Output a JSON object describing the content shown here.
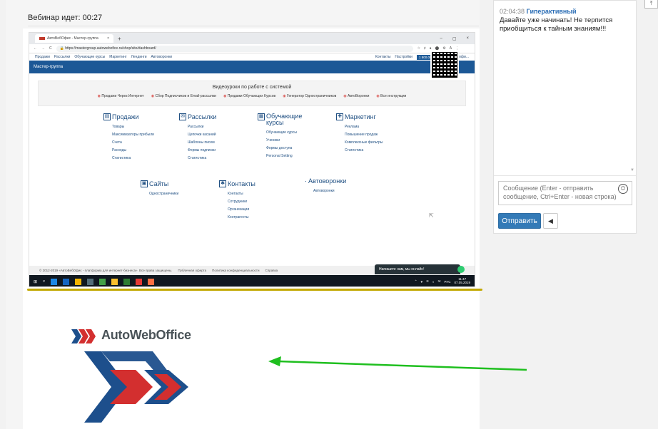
{
  "webinar": {
    "status_label": "Вебинар идет: 00:27"
  },
  "browser": {
    "tab_title": "АвтоВебОфис - Мастер-группа",
    "tab_close": "×",
    "tab_add": "+",
    "window_controls": [
      "–",
      "▢",
      "×"
    ],
    "nav_buttons": [
      "←",
      "→",
      "C"
    ],
    "url": "https://mastergroup.autowebofice.ru/shop/site/dashboard/",
    "extensions": [
      "☆",
      "♯",
      "●",
      "⬤",
      "⚙",
      "A",
      "⋮"
    ]
  },
  "site": {
    "topnav_left": [
      "Продажи",
      "Рассылки",
      "Обучающие курсы",
      "Маркетинг",
      "Лендинги",
      "Автоворонки"
    ],
    "topnav_right": [
      "Контакты",
      "Настройки"
    ],
    "balance": "1 800.00 RUB",
    "user": "Кодек в офи...",
    "header_title": "Мастер-группа",
    "video_title": "Видеоуроки по работе с системой",
    "video_links": [
      "Продажи Через Интернет",
      "Сбор Подписчиков и Email-рассылки",
      "Продажи Обучающих Курсов",
      "Генератор Одностраничников",
      "АвтоВоронки",
      "Все инструкции"
    ],
    "categories": [
      {
        "title": "Продажи",
        "icon": "▤",
        "items": [
          "Товары",
          "Максимизаторы прибыли",
          "Счета",
          "Расходы",
          "Статистика"
        ]
      },
      {
        "title": "Рассылки",
        "icon": "✉",
        "items": [
          "Рассылки",
          "Цепочки касаний",
          "Шаблоны писем",
          "Формы подписки",
          "Статистика"
        ]
      },
      {
        "title": "Обучающие курсы",
        "icon": "▦",
        "items": [
          "Обучающие курсы",
          "Ученики",
          "Формы доступа",
          "Personal Setting"
        ]
      },
      {
        "title": "Маркетинг",
        "icon": "✚",
        "items": [
          "Реклама",
          "Повышение продаж",
          "Комплексные фильтры",
          "Статистика"
        ]
      },
      {
        "title": "Сайты",
        "icon": "▣",
        "items": [
          "Одностраничники"
        ]
      },
      {
        "title": "Контакты",
        "icon": "✱",
        "items": [
          "Контакты",
          "Сотрудники",
          "Организации",
          "Контрагенты"
        ]
      },
      {
        "title": "Автоворонки",
        "icon": "·",
        "items": [
          "Автоворонки"
        ]
      }
    ],
    "footer": [
      "© 2012-2019 «АвтоВебОфис - платформа для интернет-бизнеса». Все права защищены.",
      "Публичная оферта",
      "Политика конфиденциальности",
      "Справка"
    ],
    "chat_widget": "Напишите нам, мы онлайн!",
    "cursor": "⇱"
  },
  "taskbar": {
    "start": "⊞",
    "search": "⌕",
    "lang": "РУС",
    "time": "11:47",
    "date": "07.05.2019",
    "tray": [
      "⌃",
      "♥",
      "≋",
      "◐",
      "✉"
    ],
    "apps": [
      {
        "color": "#1e88e5"
      },
      {
        "color": "#1565c0"
      },
      {
        "color": "#f4b400"
      },
      {
        "color": "#546e7a"
      },
      {
        "color": "#43a047"
      },
      {
        "color": "#fbc02d"
      },
      {
        "color": "#2e7d32"
      },
      {
        "color": "#e53935"
      },
      {
        "color": "#ff7043"
      }
    ]
  },
  "logo": {
    "text": "AutoWebOffice",
    "red": "#d32f2f",
    "blue": "#1d4f8c"
  },
  "arrow_color": "#1fbf1f",
  "chat": {
    "timestamp": "02:04:38",
    "author": "Гиперактивный",
    "message": "Давайте уже начинать! Не терпится приобщиться к тайным знаниям!!!",
    "scroll_down": "▼",
    "input_placeholder": "Сообщение (Enter - отправить сообщение, Ctrl+Enter - новая строка)",
    "emoji_button": "☺",
    "send_label": "Отправить",
    "sound_button": "◀"
  },
  "corner_button": "⤒"
}
